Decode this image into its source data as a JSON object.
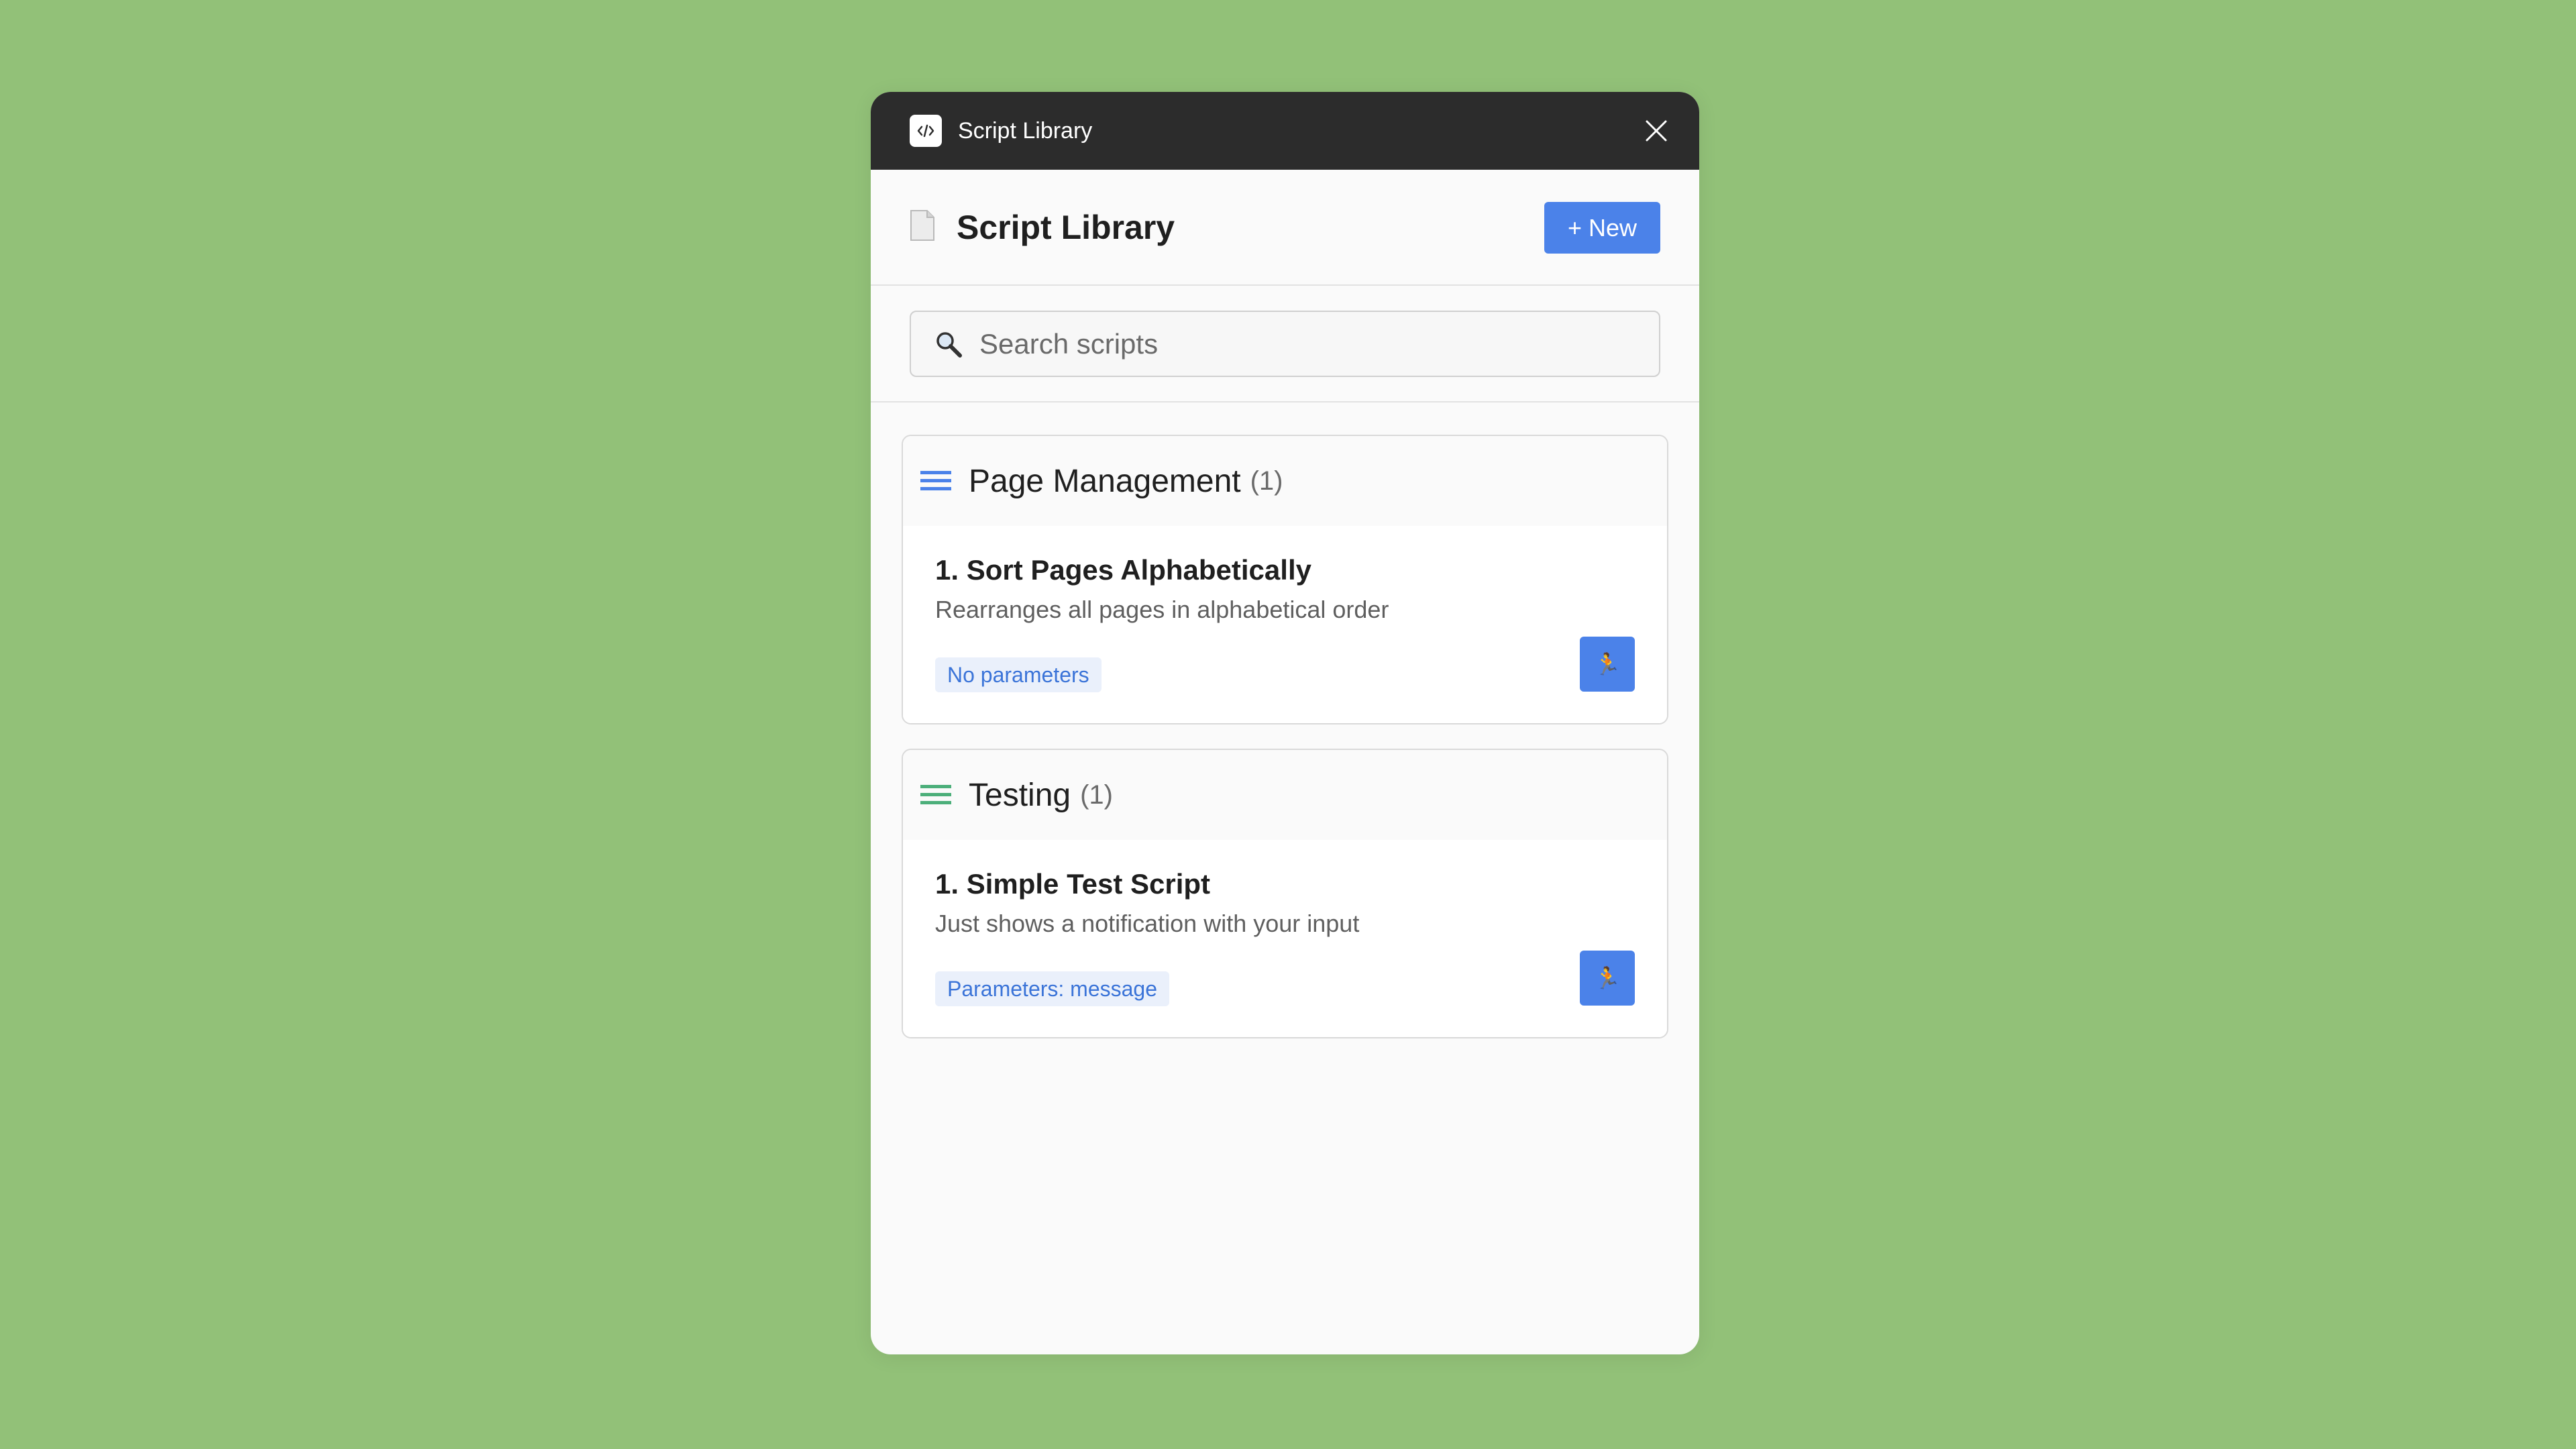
{
  "window": {
    "title": "Script Library",
    "app_icon": "code-icon",
    "close_icon": "close-icon"
  },
  "header": {
    "icon": "document-icon",
    "title": "Script Library",
    "new_button_label": "+ New"
  },
  "search": {
    "icon": "magnifier-icon",
    "placeholder": "Search scripts",
    "value": ""
  },
  "categories": [
    {
      "name": "Page Management",
      "count": "(1)",
      "icon_color": "#4b82e9",
      "scripts": [
        {
          "title": "1. Sort Pages Alphabetically",
          "description": "Rearranges all pages in alphabetical order",
          "params": "No parameters",
          "run_icon": "runner-icon"
        }
      ]
    },
    {
      "name": "Testing",
      "count": "(1)",
      "icon_color": "#4caf7a",
      "scripts": [
        {
          "title": "1. Simple Test Script",
          "description": "Just shows a notification with your input",
          "params": "Parameters: message",
          "run_icon": "runner-icon"
        }
      ]
    }
  ],
  "colors": {
    "background": "#92c178",
    "titlebar": "#2c2c2c",
    "accent": "#4b82e9",
    "badge_bg": "#eaf0fb",
    "badge_text": "#3b74d8"
  }
}
